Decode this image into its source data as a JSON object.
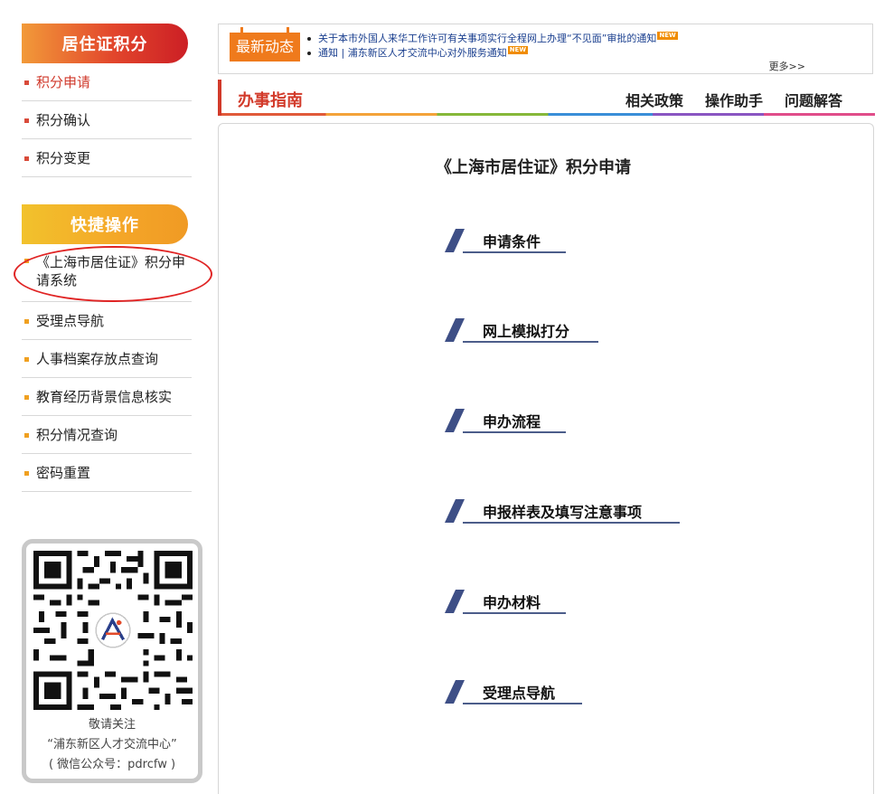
{
  "sidebar": {
    "section1_title": "居住证积分",
    "section1_items": [
      "积分申请",
      "积分确认",
      "积分变更"
    ],
    "section2_title": "快捷操作",
    "section2_items": [
      "《上海市居住证》积分申请系统",
      "受理点导航",
      "人事档案存放点查询",
      "教育经历背景信息核实",
      "积分情况查询",
      "密码重置"
    ],
    "qr": {
      "line1": "敬请关注",
      "line2": "“浦东新区人才交流中心”",
      "line3": "( 微信公众号：pdrcfw )"
    }
  },
  "news": {
    "tag": "最新动态",
    "items": [
      "关于本市外国人来华工作许可有关事项实行全程网上办理“不见面”审批的通知",
      "通知 | 浦东新区人才交流中心对外服务通知"
    ],
    "new_badge": "NEW",
    "more": "更多>>"
  },
  "guide": {
    "title": "办事指南",
    "links": [
      "相关政策",
      "操作助手",
      "问题解答"
    ]
  },
  "main": {
    "title": "《上海市居住证》积分申请",
    "sections": [
      "申请条件",
      "网上模拟打分",
      "申办流程",
      "申报样表及填写注意事项",
      "申办材料",
      "受理点导航"
    ]
  },
  "colors": {
    "accent_red": "#d23a2a",
    "accent_orange": "#ef7a1c",
    "link_blue": "#1a3f8f",
    "section_navy": "#3e4f86"
  }
}
